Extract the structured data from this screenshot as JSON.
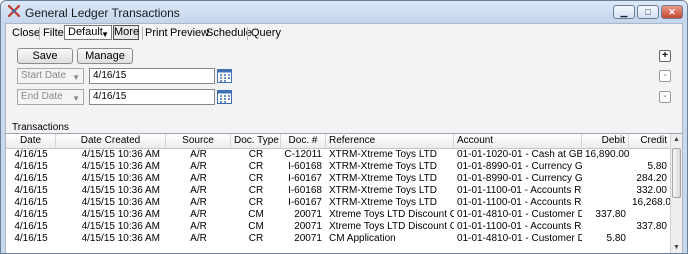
{
  "window": {
    "title": "General Ledger Transactions",
    "controls": {
      "minimize": "▁",
      "maximize": "□",
      "close": "✕"
    }
  },
  "menu": {
    "close": "Close",
    "filter_label": "Filter:",
    "filter_value": "Default",
    "more": "More",
    "print": "Print",
    "preview": "Preview",
    "schedule": "Schedule",
    "query": "Query"
  },
  "toolbar": {
    "save": "Save",
    "manage": "Manage"
  },
  "params": [
    {
      "field": "Start Date",
      "value": "4/16/15"
    },
    {
      "field": "End Date",
      "value": "4/16/15"
    }
  ],
  "side_buttons": {
    "add": "+",
    "remove": "-"
  },
  "transactions": {
    "label": "Transactions",
    "columns": {
      "date": "Date",
      "created": "Date Created",
      "source": "Source",
      "dtype": "Doc. Type",
      "docno": "Doc. #",
      "ref": "Reference",
      "acct": "Account",
      "debit": "Debit",
      "credit": "Credit"
    },
    "rows": [
      {
        "date": "4/16/15",
        "created": "4/15/15 10:36 AM",
        "source": "A/R",
        "dtype": "CR",
        "docno": "C-12011",
        "ref": "XTRM-Xtreme Toys LTD",
        "acct": "01-01-1020-01 - Cash at GBank",
        "debit": "16,890.00",
        "credit": ""
      },
      {
        "date": "4/16/15",
        "created": "4/15/15 10:36 AM",
        "source": "A/R",
        "dtype": "CR",
        "docno": "I-60168",
        "ref": "XTRM-Xtreme Toys LTD",
        "acct": "01-01-8990-01 - Currency Gain ...",
        "debit": "",
        "credit": "5.80"
      },
      {
        "date": "4/16/15",
        "created": "4/15/15 10:36 AM",
        "source": "A/R",
        "dtype": "CR",
        "docno": "I-60167",
        "ref": "XTRM-Xtreme Toys LTD",
        "acct": "01-01-8990-01 - Currency Gain ...",
        "debit": "",
        "credit": "284.20"
      },
      {
        "date": "4/16/15",
        "created": "4/15/15 10:36 AM",
        "source": "A/R",
        "dtype": "CR",
        "docno": "I-60168",
        "ref": "XTRM-Xtreme Toys LTD",
        "acct": "01-01-1100-01 - Accounts Rece...",
        "debit": "",
        "credit": "332.00"
      },
      {
        "date": "4/16/15",
        "created": "4/15/15 10:36 AM",
        "source": "A/R",
        "dtype": "CR",
        "docno": "I-60167",
        "ref": "XTRM-Xtreme Toys LTD",
        "acct": "01-01-1100-01 - Accounts Rece...",
        "debit": "",
        "credit": "16,268.00"
      },
      {
        "date": "4/16/15",
        "created": "4/15/15 10:36 AM",
        "source": "A/R",
        "dtype": "CM",
        "docno": "20071",
        "ref": "Xtreme Toys LTD Discount Cred...",
        "acct": "01-01-4810-01 - Customer Disc...",
        "debit": "337.80",
        "credit": ""
      },
      {
        "date": "4/16/15",
        "created": "4/15/15 10:36 AM",
        "source": "A/R",
        "dtype": "CM",
        "docno": "20071",
        "ref": "Xtreme Toys LTD Discount Cred...",
        "acct": "01-01-1100-01 - Accounts Rece...",
        "debit": "",
        "credit": "337.80"
      },
      {
        "date": "4/16/15",
        "created": "4/15/15 10:36 AM",
        "source": "A/R",
        "dtype": "CR",
        "docno": "20071",
        "ref": "CM Application",
        "acct": "01-01-4810-01 - Customer Disc...",
        "debit": "5.80",
        "credit": ""
      }
    ]
  },
  "scrollbar": {
    "up": "▲",
    "down": "▼"
  },
  "colors": {
    "titlebar": "#c4d6ec",
    "client": "#f3f3f3",
    "close_button": "#c4452d",
    "calendar_icon": "#3f6fb5"
  }
}
